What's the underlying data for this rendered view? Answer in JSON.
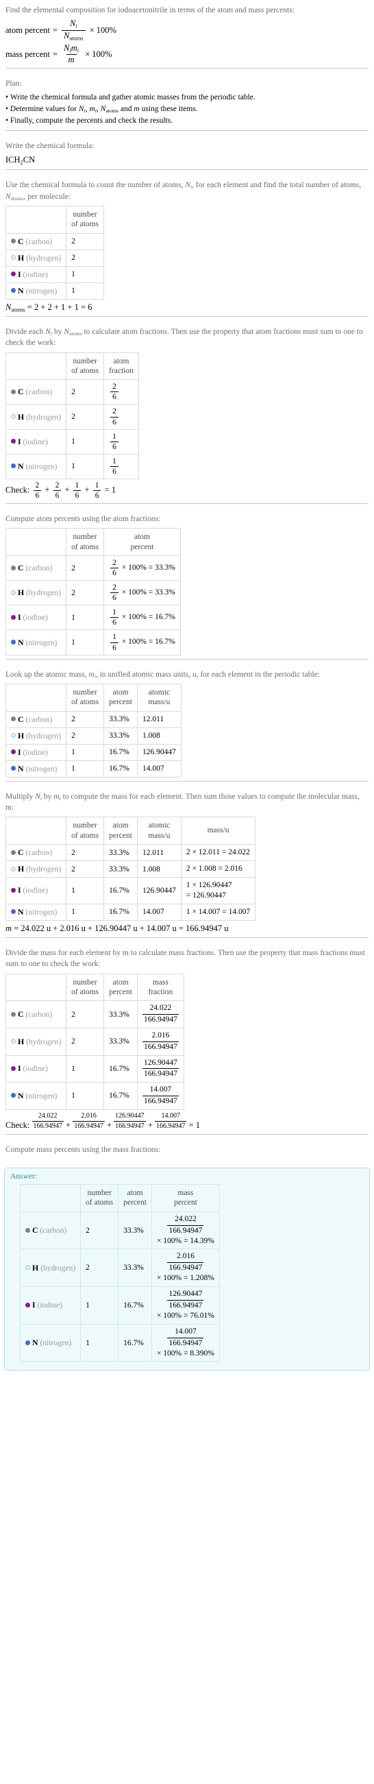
{
  "meta": {
    "compound": "iodoacetonitrile",
    "formula_main": "ICH",
    "formula_sub": "2",
    "formula_tail": "CN"
  },
  "intro": {
    "line1": "Find the elemental composition for iodoacetonitrile in terms of the atom and mass percents:",
    "atom_percent_label": "atom percent",
    "mass_percent_label": "mass percent",
    "eq_equals": "=",
    "times100": "× 100%",
    "Ni": "N",
    "Ni_sub": "i",
    "Natoms": "N",
    "Natoms_sub": "atoms",
    "Nimi_num_N": "N",
    "Nimi_num_m": "m",
    "m_den": "m"
  },
  "plan": {
    "title": "Plan:",
    "items": [
      "Write the chemical formula and gather atomic masses from the periodic table.",
      "Determine values for Nᵢ, mᵢ, Nₐₜₒₘₛ and m using these items.",
      "Finally, compute the percents and check the results."
    ],
    "item2_parts": {
      "pre": "Determine values for ",
      "post": " using these items.",
      "and": " and "
    }
  },
  "section_formula": {
    "prompt": "Write the chemical formula:",
    "formula": "ICH2CN"
  },
  "section_count": {
    "prompt": "Use the chemical formula to count the number of atoms, Nᵢ, for each element and find the total number of atoms, Nₐₜₒₘₛ, per molecule:",
    "prompt_pre": "Use the chemical formula to count the number of atoms, ",
    "prompt_mid": ", for each element and find the total number of atoms, ",
    "prompt_post": ", per molecule:",
    "headers": [
      "",
      "number of atoms"
    ],
    "natoms_sum": "Nₐₜₒₘₛ = 2 + 2 + 1 + 1 = 6",
    "natoms_sum_rhs": "= 2 + 2 + 1 + 1 = 6"
  },
  "section_fraction": {
    "prompt_pre": "Divide each ",
    "prompt_mid": " by ",
    "prompt_post": " to calculate atom fractions. Then use the property that atom fractions must sum to one to check the work:",
    "headers": [
      "",
      "number of atoms",
      "atom fraction"
    ],
    "check_label": "Check:",
    "check_terms": [
      "2/6",
      "2/6",
      "1/6",
      "1/6"
    ],
    "check_result": "= 1"
  },
  "section_atom_percent": {
    "prompt": "Compute atom percents using the atom fractions:",
    "headers": [
      "",
      "number of atoms",
      "atom percent"
    ]
  },
  "section_atomic_mass": {
    "prompt_pre": "Look up the atomic mass, ",
    "prompt_post": ", in unified atomic mass units, u, for each element in the periodic table:",
    "headers": [
      "",
      "number of atoms",
      "atom percent",
      "atomic mass/u"
    ]
  },
  "section_mass": {
    "prompt_pre": "Multiply ",
    "prompt_mid": " by ",
    "prompt_post": " to compute the mass for each element. Then sum those values to compute the molecular mass, m:",
    "headers": [
      "",
      "number of atoms",
      "atom percent",
      "atomic mass/u",
      "mass/u"
    ],
    "molecular_mass": "m = 24.022 u + 2.016 u + 126.90447 u + 14.007 u = 166.94947 u",
    "molecular_mass_rhs": "= 24.022 u + 2.016 u + 126.90447 u + 14.007 u = 166.94947 u"
  },
  "section_mass_fraction": {
    "prompt": "Divide the mass for each element by m to calculate mass fractions. Then use the property that mass fractions must sum to one to check the work:",
    "headers": [
      "",
      "number of atoms",
      "atom percent",
      "mass fraction"
    ],
    "check_label": "Check:",
    "check_result": "= 1",
    "denominator": "166.94947"
  },
  "section_answer": {
    "prompt": "Compute mass percents using the mass fractions:",
    "answer_label": "Answer:",
    "headers": [
      "",
      "number of atoms",
      "atom percent",
      "mass percent"
    ]
  },
  "elements": [
    {
      "symbol": "C",
      "name": "(carbon)",
      "color": "#808080",
      "filled": true,
      "count": "2",
      "atom_fraction_num": "2",
      "atom_fraction_den": "6",
      "atom_percent": "33.3%",
      "atom_percent_expr_suffix": "× 100% = 33.3%",
      "atomic_mass": "12.011",
      "mass_expr": "2 × 12.011 = 24.022",
      "mass_expr_l1": "2 × 12.011 = 24.022",
      "mass_expr_l2": "",
      "mass_value": "24.022",
      "mass_fraction_num": "24.022",
      "mass_fraction_den": "166.94947",
      "mass_percent": "14.39%",
      "mass_percent_line": "× 100% = 14.39%"
    },
    {
      "symbol": "H",
      "name": "(hydrogen)",
      "color": "#dff1f5",
      "filled": false,
      "count": "2",
      "atom_fraction_num": "2",
      "atom_fraction_den": "6",
      "atom_percent": "33.3%",
      "atom_percent_expr_suffix": "× 100% = 33.3%",
      "atomic_mass": "1.008",
      "mass_expr": "2 × 1.008 = 2.016",
      "mass_expr_l1": "2 × 1.008 = 2.016",
      "mass_expr_l2": "",
      "mass_value": "2.016",
      "mass_fraction_num": "2.016",
      "mass_fraction_den": "166.94947",
      "mass_percent": "1.208%",
      "mass_percent_line": "× 100% = 1.208%"
    },
    {
      "symbol": "I",
      "name": "(iodine)",
      "color": "#8b1a8b",
      "filled": true,
      "count": "1",
      "atom_fraction_num": "1",
      "atom_fraction_den": "6",
      "atom_percent": "16.7%",
      "atom_percent_expr_suffix": "× 100% = 16.7%",
      "atomic_mass": "126.90447",
      "mass_expr": "1 × 126.90447 = 126.90447",
      "mass_expr_l1": "1 × 126.90447",
      "mass_expr_l2": "= 126.90447",
      "mass_value": "126.90447",
      "mass_fraction_num": "126.90447",
      "mass_fraction_den": "166.94947",
      "mass_percent": "76.01%",
      "mass_percent_line": "× 100% = 76.01%"
    },
    {
      "symbol": "N",
      "name": "(nitrogen)",
      "color": "#4169c8",
      "filled": true,
      "count": "1",
      "atom_fraction_num": "1",
      "atom_fraction_den": "6",
      "atom_percent": "16.7%",
      "atom_percent_expr_suffix": "× 100% = 16.7%",
      "atomic_mass": "14.007",
      "mass_expr": "1 × 14.007 = 14.007",
      "mass_expr_l1": "1 × 14.007 = 14.007",
      "mass_expr_l2": "",
      "mass_value": "14.007",
      "mass_fraction_num": "14.007",
      "mass_fraction_den": "166.94947",
      "mass_percent": "8.390%",
      "mass_percent_line": "× 100% = 8.390%"
    }
  ]
}
